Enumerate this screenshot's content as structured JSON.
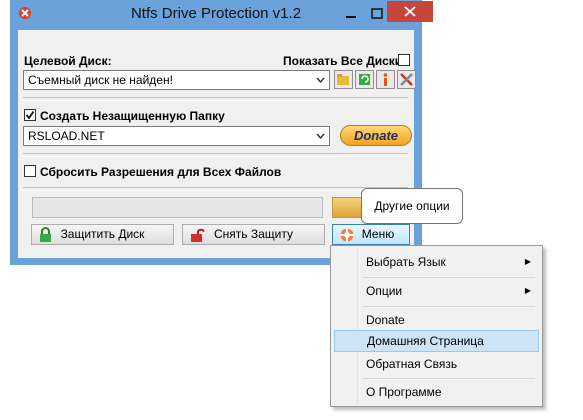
{
  "window": {
    "title": "Ntfs Drive Protection v1.2",
    "accent": "#6ba2dc",
    "close_color": "#c7463a"
  },
  "target_disk": {
    "label": "Целевой Диск:",
    "value": "Съемный диск не найден!",
    "show_all_label": "Показать Все Диски",
    "show_all_checked": false
  },
  "toolbar_icons": [
    "open-folder-icon",
    "refresh-icon",
    "info-icon",
    "tools-icon"
  ],
  "unprotected_folder": {
    "label": "Создать Незащищенную Папку",
    "checked": true,
    "value": "RSLOAD.NET",
    "donate_label": "Donate"
  },
  "reset_permissions": {
    "label": "Сбросить Разрешения для Всех Файлов",
    "checked": false
  },
  "progress": {
    "value": 0
  },
  "buttons": {
    "protect": "Защитить Диск",
    "unprotect": "Снять Защиту",
    "menu": "Меню"
  },
  "tooltip": "Другие опции",
  "menu": {
    "items": [
      {
        "label": "Выбрать Язык",
        "submenu": true
      },
      {
        "label": "Опции",
        "submenu": true
      },
      {
        "label": "Donate",
        "submenu": false
      },
      {
        "label": "Домашняя Страница",
        "submenu": false,
        "highlighted": true
      },
      {
        "label": "Обратная Связь",
        "submenu": false
      },
      {
        "label": "О Программе",
        "submenu": false
      }
    ]
  }
}
